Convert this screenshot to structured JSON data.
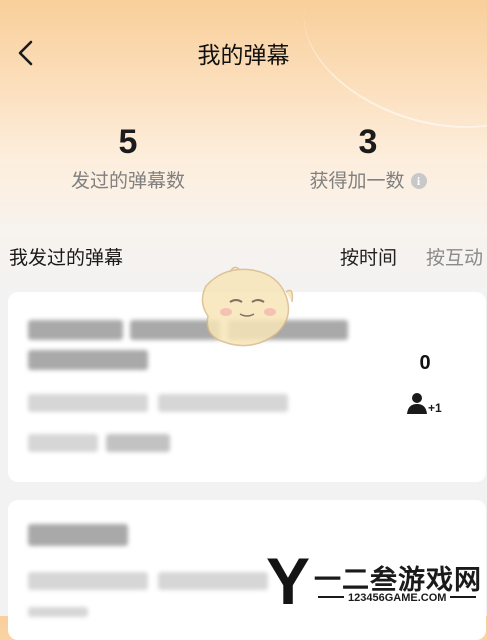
{
  "header": {
    "title": "我的弹幕",
    "back_icon": "chevron-left-icon"
  },
  "stats": [
    {
      "value": "5",
      "label": "发过的弹幕数"
    },
    {
      "value": "3",
      "label": "获得加一数",
      "info_icon": "info-icon",
      "info_glyph": "i"
    }
  ],
  "section": {
    "title": "我发过的弹幕",
    "sort_options": [
      "按时间",
      "按互动"
    ],
    "sort_selected": "按时间"
  },
  "items": [
    {
      "plus_one_count": "0",
      "plus_icon": "user-plus-one-icon",
      "plus_label": "+1"
    }
  ],
  "watermark": {
    "letter": "Y",
    "text": "一二叁游戏网",
    "url": "123456GAME.COM"
  },
  "colors": {
    "header_gradient_top": "#f9cf9a",
    "background": "#f3f2f2",
    "card": "#ffffff",
    "muted": "#808080"
  }
}
